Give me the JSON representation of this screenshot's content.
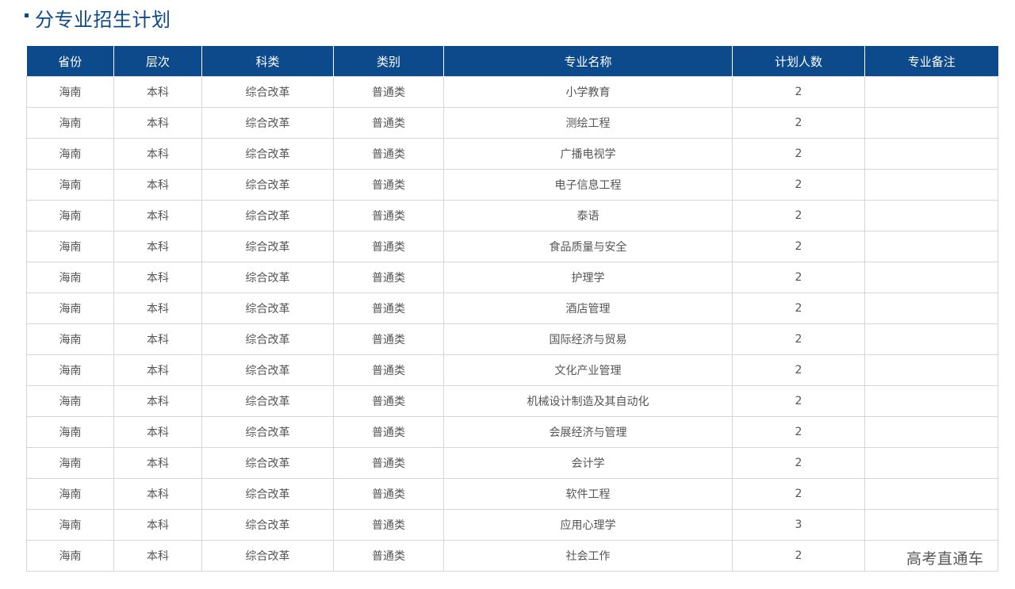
{
  "section": {
    "title": "分专业招生计划"
  },
  "table": {
    "headers": [
      "省份",
      "层次",
      "科类",
      "类别",
      "专业名称",
      "计划人数",
      "专业备注"
    ],
    "rows": [
      [
        "海南",
        "本科",
        "综合改革",
        "普通类",
        "小学教育",
        "2",
        ""
      ],
      [
        "海南",
        "本科",
        "综合改革",
        "普通类",
        "测绘工程",
        "2",
        ""
      ],
      [
        "海南",
        "本科",
        "综合改革",
        "普通类",
        "广播电视学",
        "2",
        ""
      ],
      [
        "海南",
        "本科",
        "综合改革",
        "普通类",
        "电子信息工程",
        "2",
        ""
      ],
      [
        "海南",
        "本科",
        "综合改革",
        "普通类",
        "泰语",
        "2",
        ""
      ],
      [
        "海南",
        "本科",
        "综合改革",
        "普通类",
        "食品质量与安全",
        "2",
        ""
      ],
      [
        "海南",
        "本科",
        "综合改革",
        "普通类",
        "护理学",
        "2",
        ""
      ],
      [
        "海南",
        "本科",
        "综合改革",
        "普通类",
        "酒店管理",
        "2",
        ""
      ],
      [
        "海南",
        "本科",
        "综合改革",
        "普通类",
        "国际经济与贸易",
        "2",
        ""
      ],
      [
        "海南",
        "本科",
        "综合改革",
        "普通类",
        "文化产业管理",
        "2",
        ""
      ],
      [
        "海南",
        "本科",
        "综合改革",
        "普通类",
        "机械设计制造及其自动化",
        "2",
        ""
      ],
      [
        "海南",
        "本科",
        "综合改革",
        "普通类",
        "会展经济与管理",
        "2",
        ""
      ],
      [
        "海南",
        "本科",
        "综合改革",
        "普通类",
        "会计学",
        "2",
        ""
      ],
      [
        "海南",
        "本科",
        "综合改革",
        "普通类",
        "软件工程",
        "2",
        ""
      ],
      [
        "海南",
        "本科",
        "综合改革",
        "普通类",
        "应用心理学",
        "3",
        ""
      ],
      [
        "海南",
        "本科",
        "综合改革",
        "普通类",
        "社会工作",
        "2",
        ""
      ]
    ]
  },
  "watermark": {
    "text": "高考直通车"
  },
  "colors": {
    "header_bg": "#0c4a8c",
    "title": "#0c4a8c"
  }
}
